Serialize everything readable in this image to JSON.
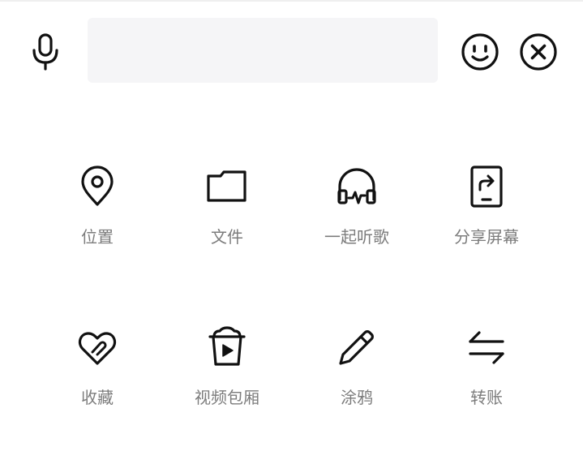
{
  "input": {
    "placeholder": "",
    "value": ""
  },
  "toolbar": {
    "left_icon": "microphone-icon",
    "right_icons": [
      "smiley-icon",
      "close-circle-icon"
    ]
  },
  "panel": {
    "items": [
      {
        "label": "位置",
        "icon": "location-pin-icon"
      },
      {
        "label": "文件",
        "icon": "folder-icon"
      },
      {
        "label": "一起听歌",
        "icon": "headphones-icon"
      },
      {
        "label": "分享屏幕",
        "icon": "share-screen-icon"
      },
      {
        "label": "收藏",
        "icon": "heart-clip-icon"
      },
      {
        "label": "视频包厢",
        "icon": "popcorn-play-icon"
      },
      {
        "label": "涂鸦",
        "icon": "pencil-icon"
      },
      {
        "label": "转账",
        "icon": "transfer-arrows-icon"
      }
    ]
  },
  "colors": {
    "icon_stroke": "#111111",
    "label_text": "#7c7c7c",
    "input_background": "#f5f5f7"
  }
}
